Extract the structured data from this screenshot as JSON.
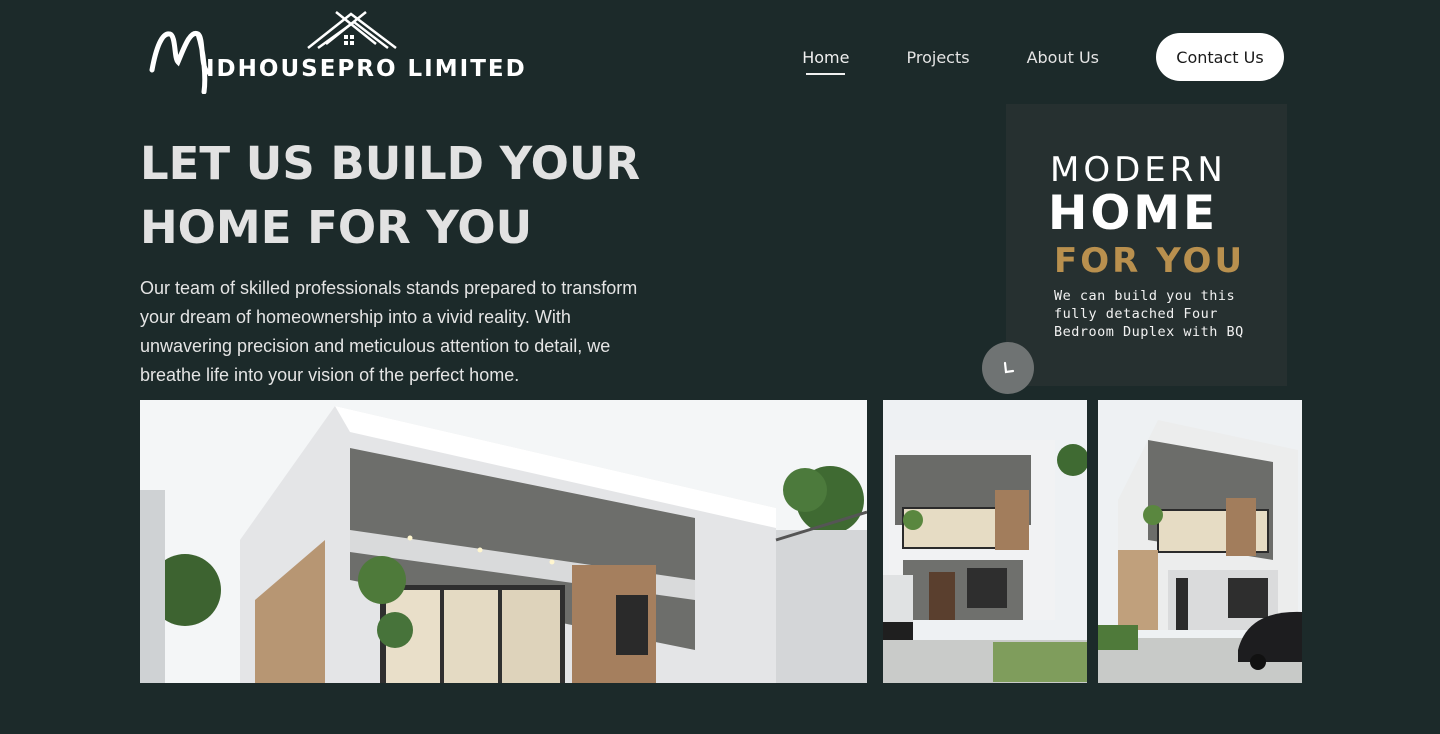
{
  "brand": {
    "logo_initial": "M",
    "name": "IDHOUSEPRO LIMITED"
  },
  "nav": {
    "items": [
      {
        "label": "Home",
        "active": true
      },
      {
        "label": "Projects",
        "active": false
      },
      {
        "label": "About Us",
        "active": false
      }
    ],
    "contact_label": "Contact Us"
  },
  "hero": {
    "title_line1": "LET US BUILD YOUR",
    "title_line2": "HOME FOR YOU",
    "description": "Our team of skilled professionals stands prepared to transform your dream of homeownership into a vivid reality. With unwavering precision and meticulous attention to detail, we breathe life into your vision of the perfect home."
  },
  "promo": {
    "line1": "MODERN",
    "line2": "HOME",
    "line3": "FOR YOU",
    "subtitle": "We can build you this fully detached Four Bedroom Duplex with BQ"
  },
  "colors": {
    "background": "#1c2a2a",
    "promo_panel": "#263030",
    "accent_gold": "#b9904e",
    "button_bg": "#ffffff"
  },
  "icons": {
    "floating_button": "clock-icon"
  }
}
